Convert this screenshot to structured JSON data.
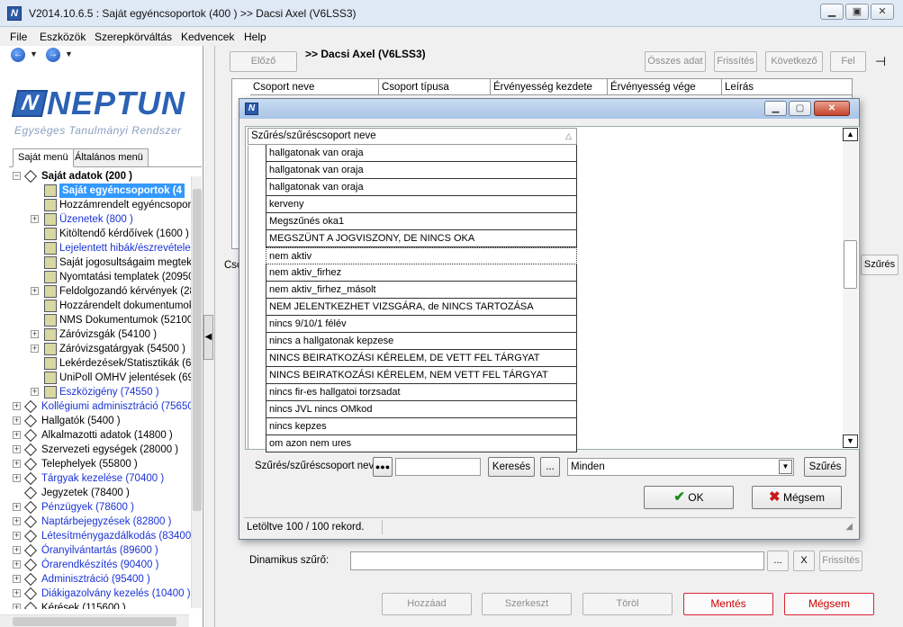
{
  "window": {
    "app_icon": "N",
    "title": "V2014.10.6.5 : Saját egyéncsoportok (400  ) >> Dacsi Axel (V6LSS3)",
    "controls": [
      "minimize-icon",
      "maximize-icon",
      "close-icon"
    ]
  },
  "menu": [
    "File",
    "Eszközök",
    "Szerepkörváltás",
    "Kedvencek",
    "Help"
  ],
  "logo": {
    "word": "NEPTUN",
    "mark": "N",
    "subtitle": "Egységes Tanulmányi Rendszer"
  },
  "left_tabs": [
    "Saját menü",
    "Általános menü"
  ],
  "tree": [
    {
      "label": "Saját adatok (200  )",
      "level": 0,
      "bold": true,
      "expander": "−",
      "icon": "diamond-icon"
    },
    {
      "label": "Saját egyéncsoportok (4",
      "level": 1,
      "selected": true,
      "icon": "document-icon"
    },
    {
      "label": "Hozzámrendelt egyéncsoporto",
      "level": 1,
      "icon": "document-icon"
    },
    {
      "label": "Üzenetek (800  )",
      "level": 1,
      "blue": true,
      "expander": "+",
      "icon": "document-icon"
    },
    {
      "label": "Kitöltendő kérdőívek (1600  )",
      "level": 1,
      "icon": "document-icon"
    },
    {
      "label": "Lejelentett hibák/észrevételek",
      "level": 1,
      "blue": true,
      "icon": "document-icon"
    },
    {
      "label": "Saját jogosultságaim megtekir",
      "level": 1,
      "icon": "document-icon"
    },
    {
      "label": "Nyomtatási templatek (20950",
      "level": 1,
      "icon": "document-icon"
    },
    {
      "label": "Feldolgozandó kérvények (28",
      "level": 1,
      "expander": "+",
      "icon": "document-icon"
    },
    {
      "label": "Hozzárendelt dokumentumok",
      "level": 1,
      "icon": "document-icon"
    },
    {
      "label": "NMS Dokumentumok (52100",
      "level": 1,
      "icon": "document-icon"
    },
    {
      "label": "Záróvizsgák (54100  )",
      "level": 1,
      "expander": "+",
      "icon": "document-icon"
    },
    {
      "label": "Záróvizsgatárgyak (54500  )",
      "level": 1,
      "expander": "+",
      "icon": "document-icon"
    },
    {
      "label": "Lekérdezések/Statisztikák (6",
      "level": 1,
      "icon": "document-icon"
    },
    {
      "label": "UniPoll OMHV jelentések (690",
      "level": 1,
      "icon": "document-icon"
    },
    {
      "label": "Eszközigény (74550  )",
      "level": 1,
      "blue": true,
      "expander": "+",
      "icon": "document-icon"
    },
    {
      "label": "Kollégiumi adminisztráció (75650",
      "level": 0,
      "blue": true,
      "expander": "+",
      "icon": "diamond-icon"
    },
    {
      "label": "Hallgatók (5400  )",
      "level": 0,
      "expander": "+",
      "icon": "diamond-icon"
    },
    {
      "label": "Alkalmazotti adatok (14800  )",
      "level": 0,
      "expander": "+",
      "icon": "diamond-icon"
    },
    {
      "label": "Szervezeti egységek (28000  )",
      "level": 0,
      "expander": "+",
      "icon": "diamond-icon"
    },
    {
      "label": "Telephelyek (55800  )",
      "level": 0,
      "expander": "+",
      "icon": "diamond-icon"
    },
    {
      "label": "Tárgyak kezelése (70400  )",
      "level": 0,
      "blue": true,
      "expander": "+",
      "icon": "diamond-icon"
    },
    {
      "label": "Jegyzetek (78400  )",
      "level": 0,
      "icon": "diamond-icon"
    },
    {
      "label": "Pénzügyek (78600  )",
      "level": 0,
      "blue": true,
      "expander": "+",
      "icon": "diamond-icon"
    },
    {
      "label": "Naptárbejegyzések (82800  )",
      "level": 0,
      "blue": true,
      "expander": "+",
      "icon": "diamond-icon"
    },
    {
      "label": "Létesítménygazdálkodás (83400",
      "level": 0,
      "blue": true,
      "expander": "+",
      "icon": "diamond-icon"
    },
    {
      "label": "Óranyilvántartás (89600  )",
      "level": 0,
      "blue": true,
      "expander": "+",
      "icon": "diamond-icon"
    },
    {
      "label": "Órarendkészítés (90400  )",
      "level": 0,
      "blue": true,
      "expander": "+",
      "icon": "diamond-icon"
    },
    {
      "label": "Adminisztráció (95400  )",
      "level": 0,
      "blue": true,
      "expander": "+",
      "icon": "diamond-icon"
    },
    {
      "label": "Diákigazolvány kezelés (10400  )",
      "level": 0,
      "blue": true,
      "expander": "+",
      "icon": "diamond-icon"
    },
    {
      "label": "Kérések (115600  )",
      "level": 0,
      "expander": "+",
      "icon": "diamond-icon"
    }
  ],
  "toolbar": {
    "prev": "Előző",
    "header": ">> Dacsi Axel (V6LSS3)",
    "all_data": "Összes adat",
    "refresh": "Frissítés",
    "next": "Következő",
    "up": "Fel",
    "pin_icon": "pin-icon"
  },
  "grid_columns": [
    "Csoport neve",
    "Csoport típusa",
    "Érvényesség kezdete",
    "Érvényesség vége",
    "Leírás"
  ],
  "background": {
    "cso_label": "Cso",
    "filter_btn": "Szűrés",
    "dynamic_filter_label": "Dinamikus szűrő:",
    "dyn_btn": "...",
    "x_btn": "X",
    "dyn_refresh": "Frissítés",
    "add": "Hozzáad",
    "edit": "Szerkeszt",
    "delete": "Töröl",
    "save": "Mentés",
    "cancel": "Mégsem"
  },
  "dialog": {
    "icon": "N",
    "list_header": "Szűrés/szűréscsoport neve",
    "rows": [
      "hallgatonak van oraja",
      "hallgatonak van oraja",
      "hallgatonak van oraja",
      "kerveny",
      "Megszűnés oka1",
      "MEGSZÜNT A JOGVISZONY, DE NINCS OKA",
      "nem aktiv",
      "nem aktiv_firhez",
      "nem aktiv_firhez_másolt",
      "NEM JELENTKEZHET VIZSGÁRA, de NINCS TARTOZÁSA",
      "nincs 9/10/1 félév",
      "nincs a hallgatonak kepzese",
      "NINCS BEIRATKOZÁSI KÉRELEM, DE VETT FEL TÁRGYAT",
      "NINCS BEIRATKOZÁSI KÉRELEM, NEM VETT FEL TÁRGYAT",
      "nincs fir-es hallgatoi torzsadat",
      "nincs JVL nincs OMkod",
      "nincs kepzes",
      "om azon nem ures"
    ],
    "current_row_index": 6,
    "filter_label": "Szűrés/szűréscsoport neve",
    "filter_value": "",
    "search_btn": "Keresés",
    "ellipsis_btn": "...",
    "combo_value": "Minden",
    "filter_btn": "Szűrés",
    "ok_btn": "OK",
    "cancel_btn": "Mégsem",
    "status": "Letöltve 100 / 100 rekord."
  }
}
